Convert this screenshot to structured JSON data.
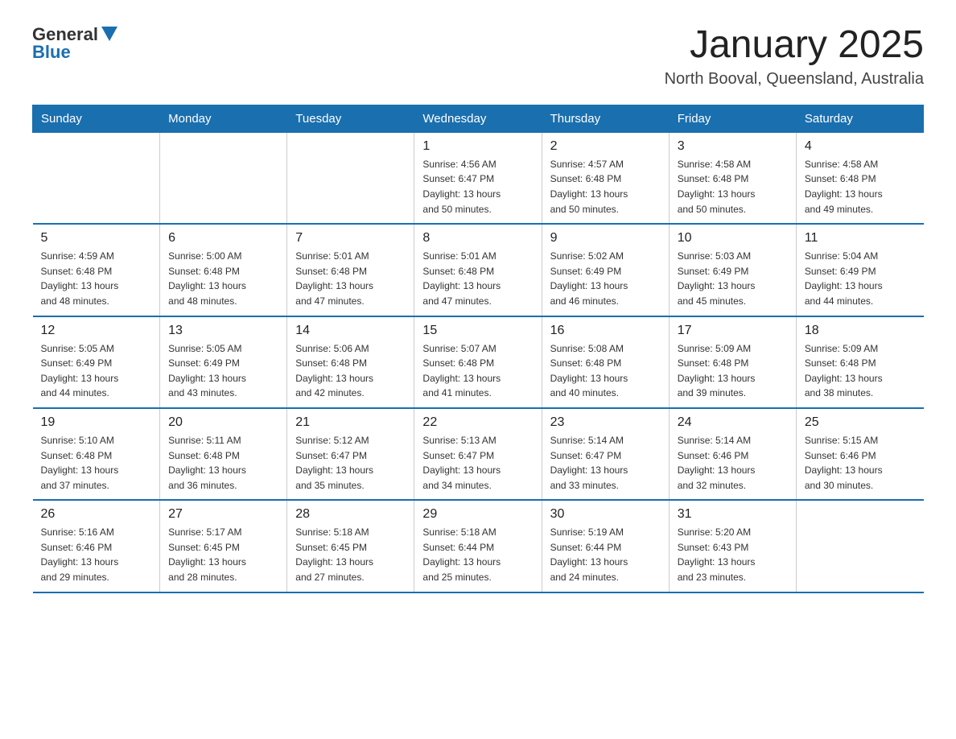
{
  "logo": {
    "general": "General",
    "blue": "Blue"
  },
  "title": "January 2025",
  "location": "North Booval, Queensland, Australia",
  "days_of_week": [
    "Sunday",
    "Monday",
    "Tuesday",
    "Wednesday",
    "Thursday",
    "Friday",
    "Saturday"
  ],
  "weeks": [
    [
      {
        "day": "",
        "info": ""
      },
      {
        "day": "",
        "info": ""
      },
      {
        "day": "",
        "info": ""
      },
      {
        "day": "1",
        "info": "Sunrise: 4:56 AM\nSunset: 6:47 PM\nDaylight: 13 hours\nand 50 minutes."
      },
      {
        "day": "2",
        "info": "Sunrise: 4:57 AM\nSunset: 6:48 PM\nDaylight: 13 hours\nand 50 minutes."
      },
      {
        "day": "3",
        "info": "Sunrise: 4:58 AM\nSunset: 6:48 PM\nDaylight: 13 hours\nand 50 minutes."
      },
      {
        "day": "4",
        "info": "Sunrise: 4:58 AM\nSunset: 6:48 PM\nDaylight: 13 hours\nand 49 minutes."
      }
    ],
    [
      {
        "day": "5",
        "info": "Sunrise: 4:59 AM\nSunset: 6:48 PM\nDaylight: 13 hours\nand 48 minutes."
      },
      {
        "day": "6",
        "info": "Sunrise: 5:00 AM\nSunset: 6:48 PM\nDaylight: 13 hours\nand 48 minutes."
      },
      {
        "day": "7",
        "info": "Sunrise: 5:01 AM\nSunset: 6:48 PM\nDaylight: 13 hours\nand 47 minutes."
      },
      {
        "day": "8",
        "info": "Sunrise: 5:01 AM\nSunset: 6:48 PM\nDaylight: 13 hours\nand 47 minutes."
      },
      {
        "day": "9",
        "info": "Sunrise: 5:02 AM\nSunset: 6:49 PM\nDaylight: 13 hours\nand 46 minutes."
      },
      {
        "day": "10",
        "info": "Sunrise: 5:03 AM\nSunset: 6:49 PM\nDaylight: 13 hours\nand 45 minutes."
      },
      {
        "day": "11",
        "info": "Sunrise: 5:04 AM\nSunset: 6:49 PM\nDaylight: 13 hours\nand 44 minutes."
      }
    ],
    [
      {
        "day": "12",
        "info": "Sunrise: 5:05 AM\nSunset: 6:49 PM\nDaylight: 13 hours\nand 44 minutes."
      },
      {
        "day": "13",
        "info": "Sunrise: 5:05 AM\nSunset: 6:49 PM\nDaylight: 13 hours\nand 43 minutes."
      },
      {
        "day": "14",
        "info": "Sunrise: 5:06 AM\nSunset: 6:48 PM\nDaylight: 13 hours\nand 42 minutes."
      },
      {
        "day": "15",
        "info": "Sunrise: 5:07 AM\nSunset: 6:48 PM\nDaylight: 13 hours\nand 41 minutes."
      },
      {
        "day": "16",
        "info": "Sunrise: 5:08 AM\nSunset: 6:48 PM\nDaylight: 13 hours\nand 40 minutes."
      },
      {
        "day": "17",
        "info": "Sunrise: 5:09 AM\nSunset: 6:48 PM\nDaylight: 13 hours\nand 39 minutes."
      },
      {
        "day": "18",
        "info": "Sunrise: 5:09 AM\nSunset: 6:48 PM\nDaylight: 13 hours\nand 38 minutes."
      }
    ],
    [
      {
        "day": "19",
        "info": "Sunrise: 5:10 AM\nSunset: 6:48 PM\nDaylight: 13 hours\nand 37 minutes."
      },
      {
        "day": "20",
        "info": "Sunrise: 5:11 AM\nSunset: 6:48 PM\nDaylight: 13 hours\nand 36 minutes."
      },
      {
        "day": "21",
        "info": "Sunrise: 5:12 AM\nSunset: 6:47 PM\nDaylight: 13 hours\nand 35 minutes."
      },
      {
        "day": "22",
        "info": "Sunrise: 5:13 AM\nSunset: 6:47 PM\nDaylight: 13 hours\nand 34 minutes."
      },
      {
        "day": "23",
        "info": "Sunrise: 5:14 AM\nSunset: 6:47 PM\nDaylight: 13 hours\nand 33 minutes."
      },
      {
        "day": "24",
        "info": "Sunrise: 5:14 AM\nSunset: 6:46 PM\nDaylight: 13 hours\nand 32 minutes."
      },
      {
        "day": "25",
        "info": "Sunrise: 5:15 AM\nSunset: 6:46 PM\nDaylight: 13 hours\nand 30 minutes."
      }
    ],
    [
      {
        "day": "26",
        "info": "Sunrise: 5:16 AM\nSunset: 6:46 PM\nDaylight: 13 hours\nand 29 minutes."
      },
      {
        "day": "27",
        "info": "Sunrise: 5:17 AM\nSunset: 6:45 PM\nDaylight: 13 hours\nand 28 minutes."
      },
      {
        "day": "28",
        "info": "Sunrise: 5:18 AM\nSunset: 6:45 PM\nDaylight: 13 hours\nand 27 minutes."
      },
      {
        "day": "29",
        "info": "Sunrise: 5:18 AM\nSunset: 6:44 PM\nDaylight: 13 hours\nand 25 minutes."
      },
      {
        "day": "30",
        "info": "Sunrise: 5:19 AM\nSunset: 6:44 PM\nDaylight: 13 hours\nand 24 minutes."
      },
      {
        "day": "31",
        "info": "Sunrise: 5:20 AM\nSunset: 6:43 PM\nDaylight: 13 hours\nand 23 minutes."
      },
      {
        "day": "",
        "info": ""
      }
    ]
  ]
}
